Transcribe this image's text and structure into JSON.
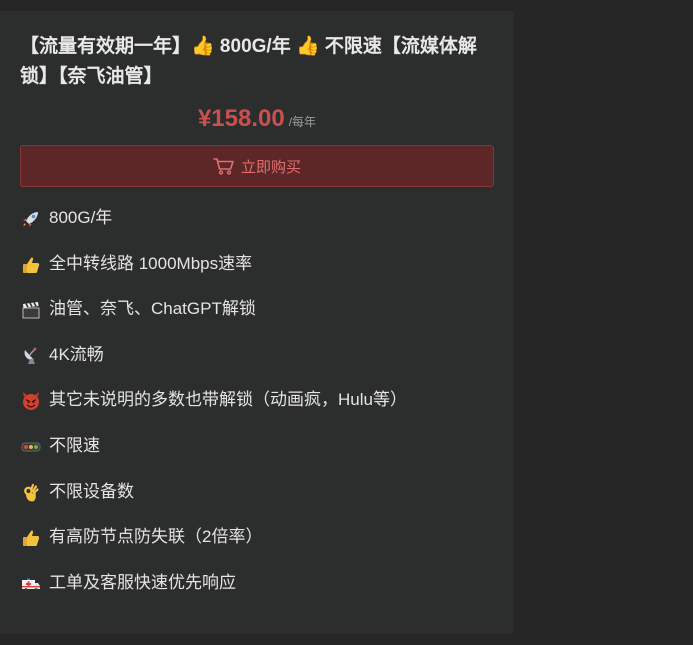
{
  "product": {
    "title": "【流量有效期一年】👍 800G/年 👍 不限速【流媒体解锁】【奈飞油管】",
    "price": "¥158.00",
    "period": "/每年",
    "buy_label": "立即购买"
  },
  "features": [
    {
      "icon": "rocket-icon",
      "text": "800G/年"
    },
    {
      "icon": "thumbs-up-icon",
      "text": "全中转线路 1000Mbps速率"
    },
    {
      "icon": "clapper-board-icon",
      "text": "油管、奈飞、ChatGPT解锁"
    },
    {
      "icon": "satellite-dish-icon",
      "text": "4K流畅"
    },
    {
      "icon": "devil-face-icon",
      "text": "其它未说明的多数也带解锁（动画疯，Hulu等）"
    },
    {
      "icon": "traffic-light-icon",
      "text": "不限速"
    },
    {
      "icon": "ok-hand-icon",
      "text": "不限设备数"
    },
    {
      "icon": "thumbs-up-icon",
      "text": "有高防节点防失联（2倍率）"
    },
    {
      "icon": "ambulance-icon",
      "text": "工单及客服快速优先响应"
    }
  ],
  "colors": {
    "price": "#c9504f",
    "button_bg": "#5d2627",
    "button_text": "#e07070",
    "card_bg": "#2c2d2d",
    "page_bg": "#262626"
  }
}
